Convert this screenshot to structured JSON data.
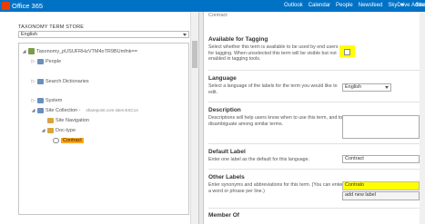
{
  "suite": {
    "brand": "Office 365",
    "nav": [
      "Outlook",
      "Calendar",
      "People",
      "Newsfeed",
      "SkyDrive",
      "Sites"
    ],
    "admin": "Adme"
  },
  "left": {
    "store_header": "TAXONOMY TERM STORE",
    "language": "English",
    "tree": [
      {
        "label": "Taxonomy_pUSUFRHzVTM4oTR9BUmfnk==",
        "icon": "store-icon",
        "toggle": "◢"
      },
      {
        "label": "People",
        "icon": "group-icon",
        "toggle": "▷"
      },
      {
        "label": "Search Dictionaries",
        "icon": "group-icon",
        "toggle": "▷"
      },
      {
        "label": "System",
        "icon": "group-icon",
        "toggle": "▷"
      },
      {
        "label": "Site Collection -",
        "url": "sharepoint.com-sites-ESC14",
        "icon": "group-icon",
        "toggle": "◢"
      },
      {
        "label": "Site Navigation",
        "icon": "termset-icon",
        "toggle": ""
      },
      {
        "label": "Doc-type",
        "icon": "termset-icon",
        "toggle": "◢"
      },
      {
        "label": "Contract",
        "icon": "term-icon",
        "toggle": ""
      }
    ]
  },
  "right": {
    "cropped_header": "Contract",
    "tagging": {
      "title": "Available for Tagging",
      "desc": "Select whether this term is available to be used by end users for tagging. When unselected this term will be visible but not enabled in tagging tools."
    },
    "language": {
      "title": "Language",
      "desc": "Select a language of the labels for the term you would like to edit.",
      "value": "English"
    },
    "description": {
      "title": "Description",
      "desc": "Descriptions will help users know when to use this term, and to disambiguate among similar terms."
    },
    "default_label": {
      "title": "Default Label",
      "desc": "Enter one label as the default for this language.",
      "value": "Contract"
    },
    "other_labels": {
      "title": "Other Labels",
      "desc": "Enter synonyms and abbreviations for this term. (You can enter a word or phrase per line.)",
      "value": "Contrato",
      "add_placeholder": "add new label"
    },
    "member_of": {
      "title": "Member Of"
    }
  },
  "colors": {
    "suite_bar": "#0072c6",
    "selected_term": "#ffa51f",
    "highlight": "#ffff00"
  }
}
